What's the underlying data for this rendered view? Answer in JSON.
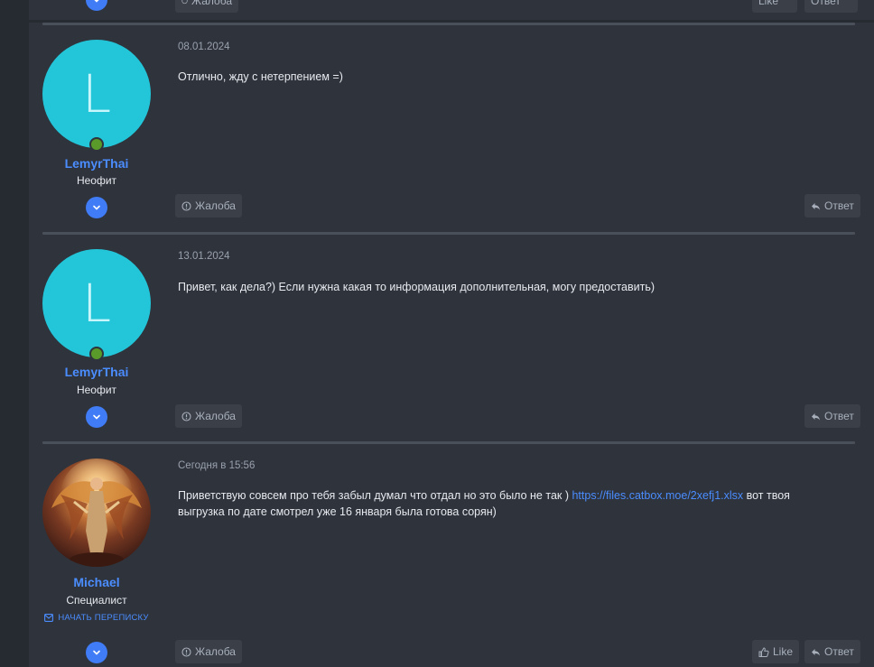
{
  "prev_post": {
    "report_label": "Жалоба",
    "like_label": "Like",
    "reply_label": "Ответ"
  },
  "posts": [
    {
      "date": "08.01.2024",
      "message": "Отлично, жду с нетерпением =)",
      "user": {
        "initial": "L",
        "name": "LemyrThai",
        "title": "Неофит"
      },
      "report_label": "Жалоба",
      "reply_label": "Ответ"
    },
    {
      "date": "13.01.2024",
      "message": "Привет, как дела?) Если нужна какая то информация дополнительная, могу предоставить)",
      "user": {
        "initial": "L",
        "name": "LemyrThai",
        "title": "Неофит"
      },
      "report_label": "Жалоба",
      "reply_label": "Ответ"
    },
    {
      "date": "Сегодня в 15:56",
      "message_before": "Приветствую совсем про тебя забыл думал что отдал но это было не так ) ",
      "message_link": "https://files.catbox.moe/2xefj1.xlsx",
      "message_after": " вот твоя выгрузка по дате смотрел уже 16 января была готова сорян)",
      "user": {
        "name": "Michael",
        "title": "Специалист",
        "pm_label": "НАЧАТЬ ПЕРЕПИСКУ"
      },
      "report_label": "Жалоба",
      "like_label": "Like",
      "reply_label": "Ответ"
    }
  ],
  "colors": {
    "page_bg": "#262a31",
    "post_bg": "#2e333c",
    "accent": "#4b8dff",
    "avatar_bg": "#23c6d9",
    "button_bg": "#3a3f48"
  }
}
